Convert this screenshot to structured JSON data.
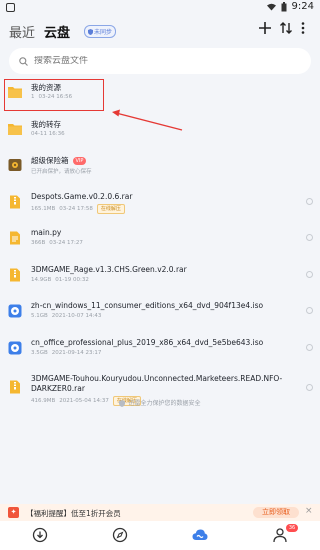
{
  "status_bar": {
    "time": "9:24"
  },
  "header": {
    "tab_recent": "最近",
    "tab_cloud": "云盘",
    "badge": "未同步",
    "add_icon": "plus-icon",
    "sort_icon": "sort-icon",
    "more_icon": "more-icon"
  },
  "search": {
    "placeholder": "搜索云盘文件"
  },
  "files": [
    {
      "name": "我的资源",
      "date": "03-24 16:56",
      "count": "1",
      "icon": "folder-icon"
    },
    {
      "name": "我的转存",
      "date": "04-11 16:36",
      "icon": "folder-icon"
    },
    {
      "name": "超级保险箱",
      "vip": "VIP",
      "meta": "已开启保护，请放心保存",
      "icon": "safe-icon"
    },
    {
      "name": "Despots.Game.v0.2.0.6.rar",
      "size": "165.1MB",
      "date": "03-24 17:58",
      "tag": "在线解压",
      "icon": "archive-icon"
    },
    {
      "name": "main.py",
      "size": "366B",
      "date": "03-24 17:27",
      "icon": "doc-icon"
    },
    {
      "name": "3DMGAME_Rage.v1.3.CHS.Green.v2.0.rar",
      "size": "14.9GB",
      "date": "01-19 00:32",
      "icon": "archive-icon"
    },
    {
      "name": "zh-cn_windows_11_consumer_editions_x64_dvd_904f13e4.iso",
      "size": "5.1GB",
      "date": "2021-10-07 14:43",
      "icon": "disc-icon"
    },
    {
      "name": "cn_office_professional_plus_2019_x86_x64_dvd_5e5be643.iso",
      "size": "3.5GB",
      "date": "2021-09-14 23:17",
      "icon": "disc-icon"
    },
    {
      "name": "3DMGAME-Touhou.Kouryudou.Unconnected.Marketeers.READ.NFO-DARKZER0.rar",
      "name_line1": "3DMGAME-Touhou.Kouryudou.Unconnected.Marketeers.READ.NFO-",
      "name_line2": "DARKZER0.rar",
      "size": "416.9MB",
      "date": "2021-05-04 14:37",
      "tag": "在线解压",
      "icon": "archive-icon"
    }
  ],
  "footer_note": "迅雷全力保护您的数据安全",
  "promo": {
    "text": "【福利提醒】低至1折开会员",
    "button": "立即领取",
    "close": "×"
  },
  "bottom_nav": {
    "items": [
      "download-icon",
      "discover-icon",
      "cloud-icon",
      "profile-icon"
    ],
    "badge": "36"
  },
  "colors": {
    "folder": "#f5b731",
    "accent": "#3d7fe9",
    "highlight": "#e53935"
  }
}
